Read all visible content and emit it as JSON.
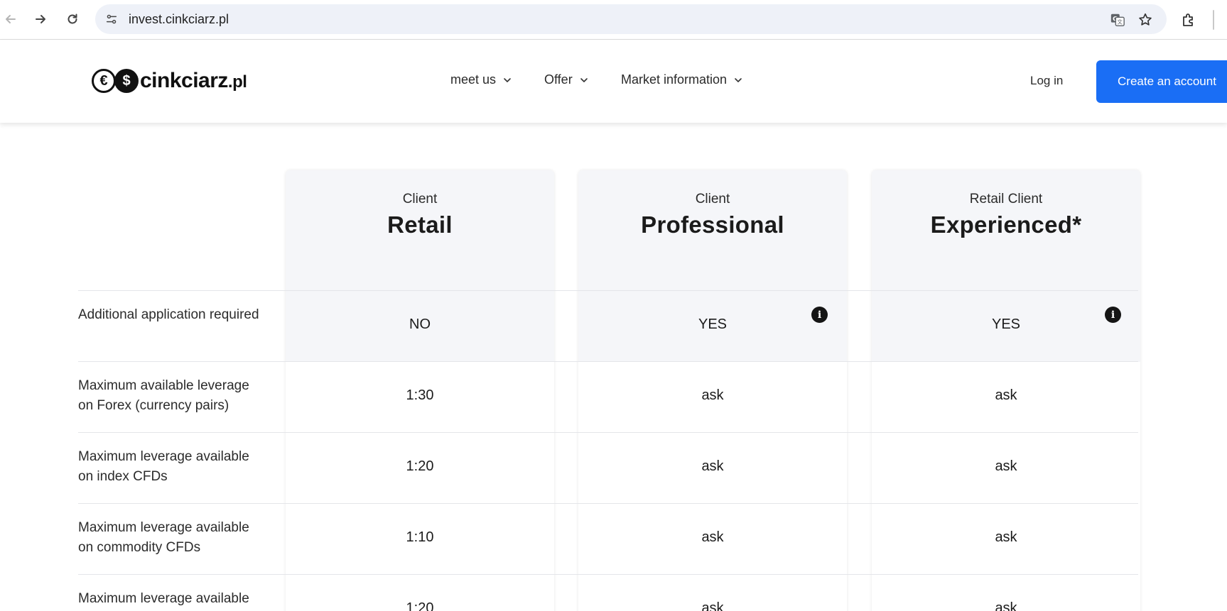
{
  "browser": {
    "url": "invest.cinkciarz.pl",
    "icons": [
      "back-arrow-icon",
      "forward-arrow-icon",
      "reload-icon",
      "site-info-icon",
      "translate-icon",
      "bookmark-star-icon",
      "extensions-icon"
    ]
  },
  "header": {
    "logo_text": "cinkciarz",
    "logo_tld": ".pl",
    "logo_coin_euro": "€",
    "logo_coin_dollar": "$",
    "nav": [
      {
        "label": "meet us"
      },
      {
        "label": "Offer"
      },
      {
        "label": "Market information"
      }
    ],
    "login_label": "Log in",
    "cta_label": "Create an account",
    "cta_color": "#1a6ef5"
  },
  "table": {
    "columns": [
      {
        "sub": "Client",
        "title": "Retail"
      },
      {
        "sub": "Client",
        "title": "Professional"
      },
      {
        "sub": "Retail Client",
        "title": "Experienced*"
      }
    ],
    "info_glyph": "i",
    "rows": [
      {
        "label": "Additional application required",
        "values": [
          "NO",
          "YES",
          "YES"
        ]
      },
      {
        "label": "Maximum available leverage on Forex (currency pairs)",
        "values": [
          "1:30",
          "ask",
          "ask"
        ]
      },
      {
        "label": "Maximum leverage available on index CFDs",
        "values": [
          "1:20",
          "ask",
          "ask"
        ]
      },
      {
        "label": "Maximum leverage available on commodity CFDs",
        "values": [
          "1:10",
          "ask",
          "ask"
        ]
      },
      {
        "label": "Maximum leverage available",
        "values": [
          "1:20",
          "ask",
          "ask"
        ]
      }
    ]
  }
}
